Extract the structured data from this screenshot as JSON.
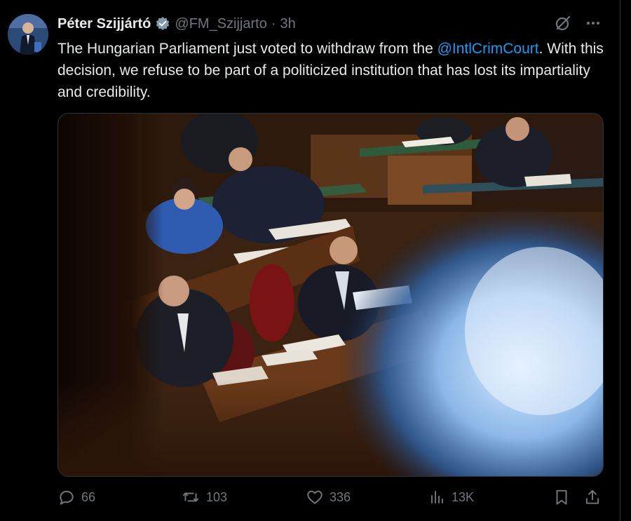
{
  "tweet": {
    "author": {
      "display_name": "Péter Szijjártó",
      "handle": "@FM_Szijjarto",
      "separator": "·",
      "time": "3h",
      "verified": true
    },
    "text": {
      "before_mention": "The Hungarian Parliament just voted to withdraw from the ",
      "mention": "@IntlCrimCourt",
      "after_mention": ". With this decision, we refuse to be part of a politicized institution that has lost its impartiality and credibility."
    },
    "header_icons": [
      "grok-icon",
      "more-icon"
    ],
    "actions": {
      "replies": "66",
      "reposts": "103",
      "likes": "336",
      "views": "13K"
    },
    "action_icons": [
      "reply-icon",
      "repost-icon",
      "like-icon",
      "views-icon",
      "bookmark-icon",
      "share-icon"
    ]
  },
  "colors": {
    "background": "#000000",
    "text": "#e7e9ea",
    "secondary": "#71767b",
    "accent": "#1d9bf0",
    "border": "#2f3336"
  }
}
